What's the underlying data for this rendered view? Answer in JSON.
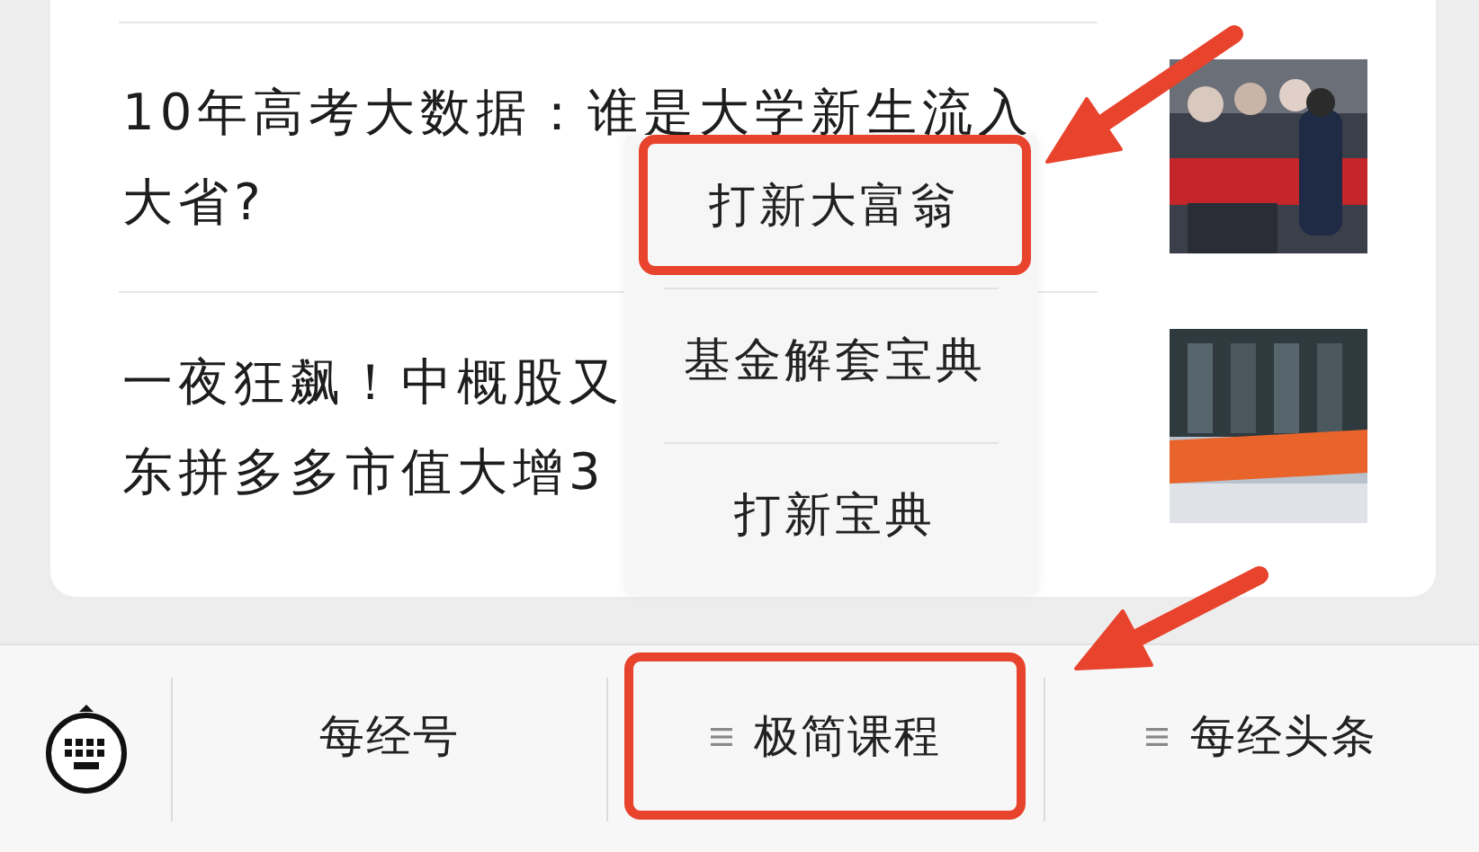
{
  "articles": [
    {
      "lines": [
        "10年高考大数据：谁是大学新生流入",
        "大省?"
      ],
      "thumbnail": {
        "kind": "picture"
      }
    },
    {
      "lines": [
        "一夜狂飙！中概股又",
        "东拼多多市值大增3"
      ],
      "thumbnail": {
        "kind": "picture"
      }
    }
  ],
  "popup_menu": {
    "items": [
      {
        "label": "打新大富翁",
        "highlighted": true
      },
      {
        "label": "基金解套宝典",
        "highlighted": false
      },
      {
        "label": "打新宝典",
        "highlighted": false
      }
    ]
  },
  "bottom_bar": {
    "tabs": [
      {
        "label": "每经号",
        "has_menu": false,
        "highlighted": false
      },
      {
        "label": "极简课程",
        "has_menu": true,
        "highlighted": true
      },
      {
        "label": "每经头条",
        "has_menu": true,
        "highlighted": false
      }
    ]
  }
}
